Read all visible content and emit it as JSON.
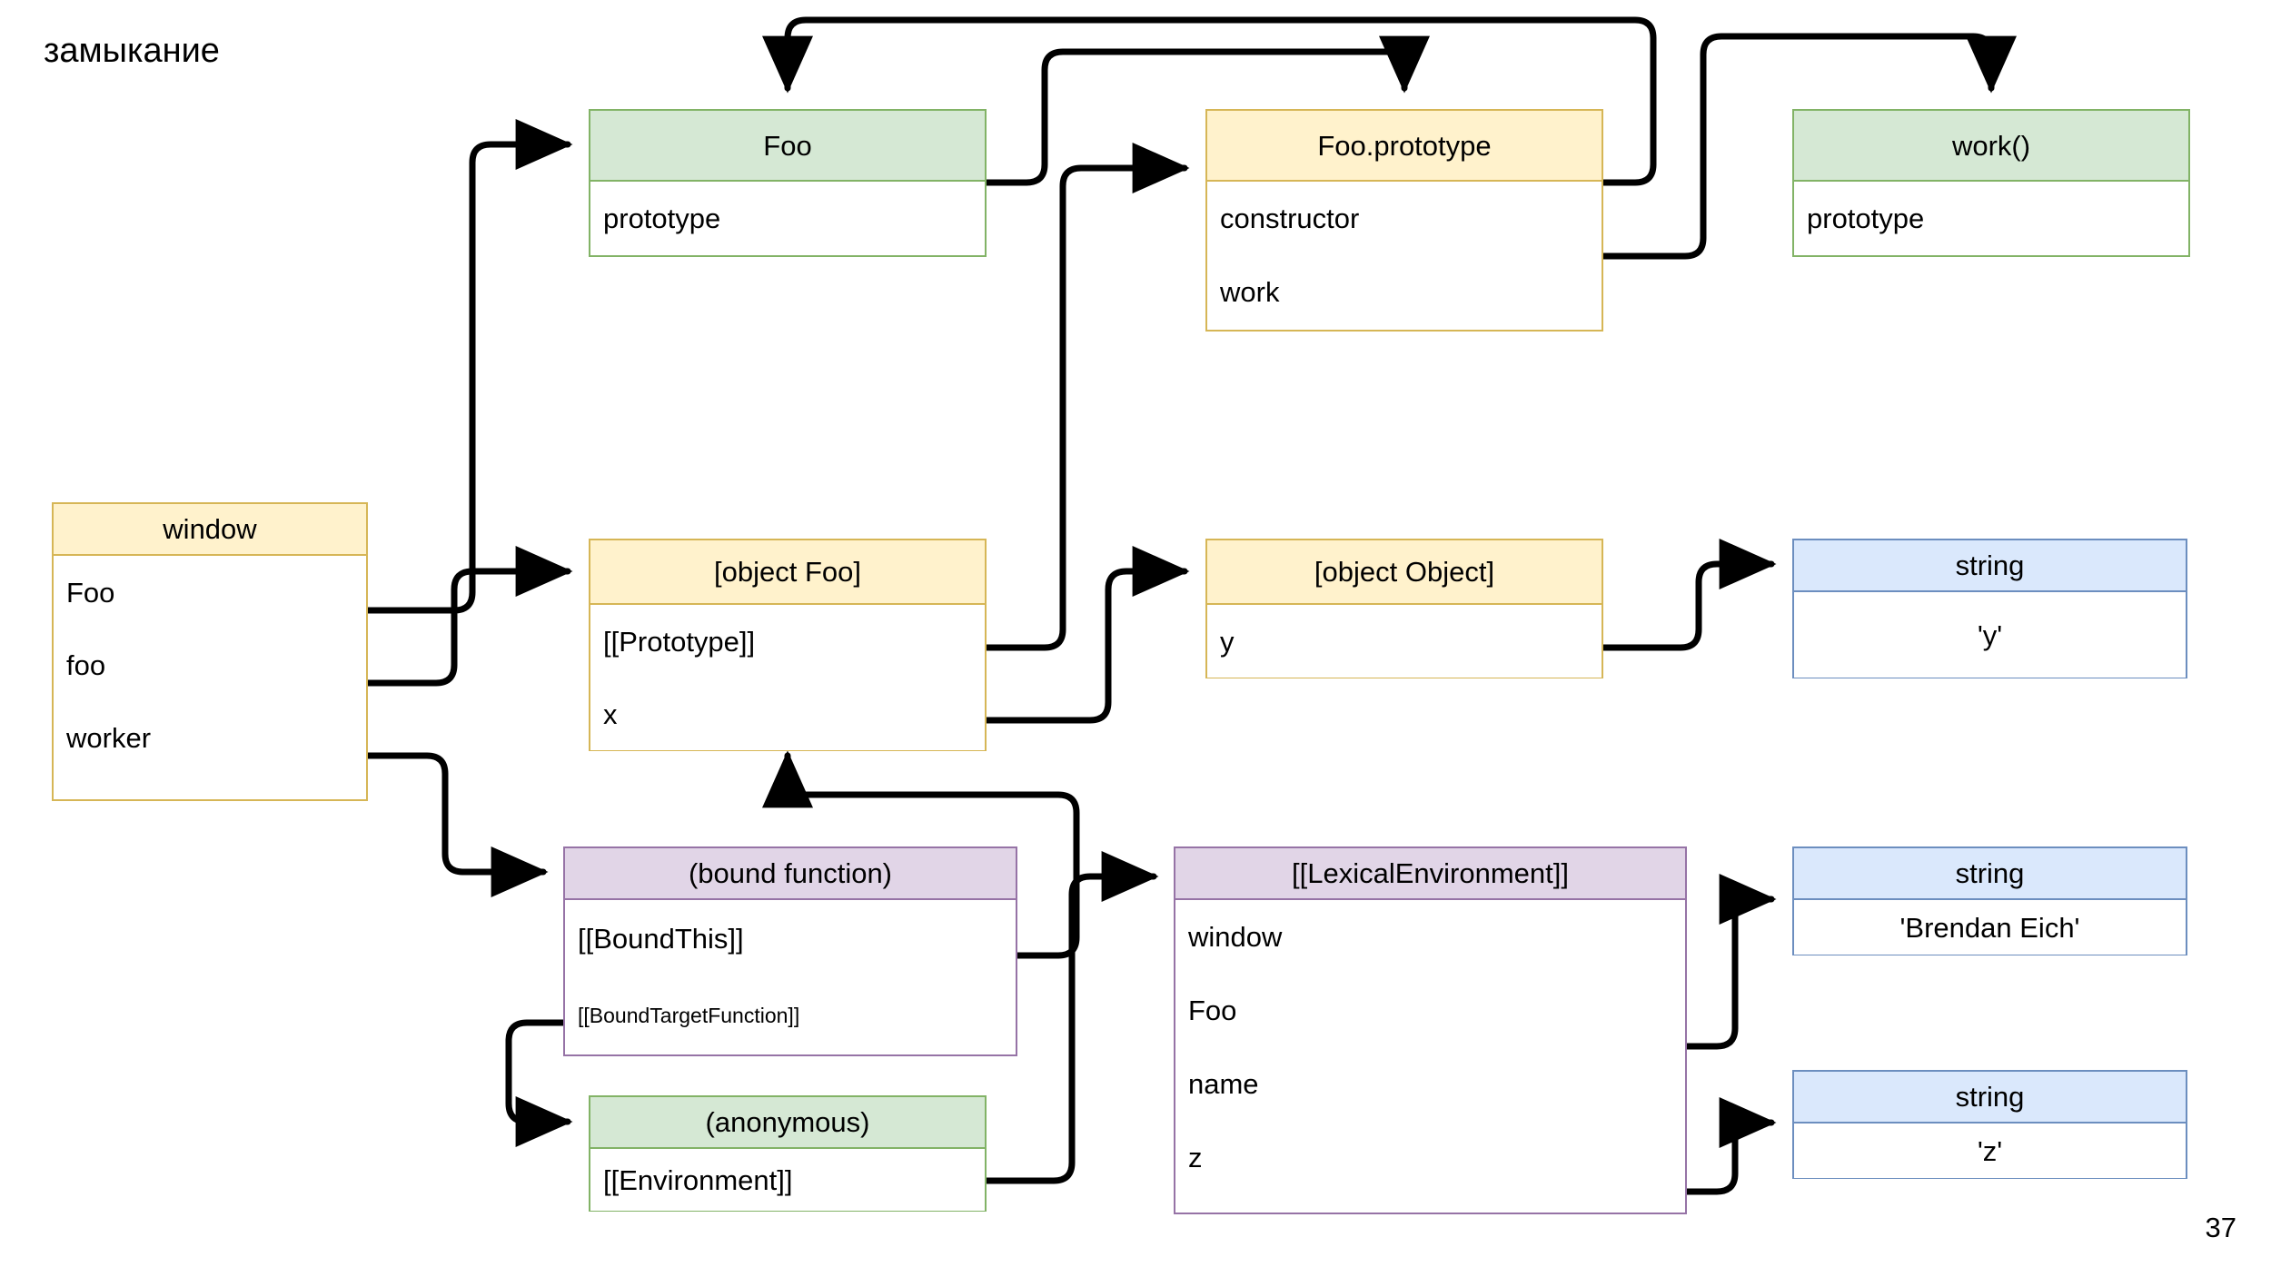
{
  "slide": {
    "title": "замыкание",
    "page_number": "37"
  },
  "colors": {
    "green_fill": "#d5e8d4",
    "green_stroke": "#82b366",
    "yellow_fill": "#fff2cc",
    "yellow_stroke": "#d6b656",
    "blue_fill": "#dae8fc",
    "blue_stroke": "#6c8ebf",
    "purple_fill": "#e1d5e7",
    "purple_stroke": "#9673a6",
    "edge_stroke": "#000000",
    "page_background": "#ffffff"
  },
  "nodes": {
    "foo": {
      "title": "Foo",
      "rows": [
        "prototype"
      ]
    },
    "foo_proto": {
      "title": "Foo.prototype",
      "rows": [
        "constructor",
        "work"
      ]
    },
    "work": {
      "title": "work()",
      "rows": [
        "prototype"
      ]
    },
    "window": {
      "title": "window",
      "rows": [
        "Foo",
        "foo",
        "worker"
      ]
    },
    "object_foo": {
      "title": "[object Foo]",
      "rows": [
        "[[Prototype]]",
        "x"
      ]
    },
    "object_obj": {
      "title": "[object Object]",
      "rows": [
        "y"
      ]
    },
    "string_y": {
      "title": "string",
      "rows": [
        "'y'"
      ]
    },
    "bound_fn": {
      "title": "(bound function)",
      "rows": [
        "[[BoundThis]]",
        "[[BoundTargetFunction]]"
      ]
    },
    "lex_env": {
      "title": "[[LexicalEnvironment]]",
      "rows": [
        "window",
        "Foo",
        "name",
        "z"
      ]
    },
    "string_be": {
      "title": "string",
      "rows": [
        "'Brendan Eich'"
      ]
    },
    "anonymous": {
      "title": "(anonymous)",
      "rows": [
        "[[Environment]]"
      ]
    },
    "string_z": {
      "title": "string",
      "rows": [
        "'z'"
      ]
    }
  },
  "edges": [
    {
      "from": "window.Foo",
      "to": "foo.header"
    },
    {
      "from": "window.foo",
      "to": "object_foo.header"
    },
    {
      "from": "window.worker",
      "to": "bound_fn.header"
    },
    {
      "from": "foo.prototype",
      "to": "foo_proto.header"
    },
    {
      "from": "foo_proto.constructor",
      "to": "foo.header"
    },
    {
      "from": "foo_proto.work",
      "to": "work.header"
    },
    {
      "from": "object_foo.[[Prototype]]",
      "to": "foo_proto.header"
    },
    {
      "from": "object_foo.x",
      "to": "object_obj.header"
    },
    {
      "from": "object_obj.y",
      "to": "string_y.header"
    },
    {
      "from": "bound_fn.[[BoundThis]]",
      "to": "object_foo.bottom"
    },
    {
      "from": "bound_fn.[[BoundTargetFunction]]",
      "to": "anonymous.header"
    },
    {
      "from": "anonymous.[[Environment]]",
      "to": "lex_env.header"
    },
    {
      "from": "lex_env.name",
      "to": "string_be.header"
    },
    {
      "from": "lex_env.z",
      "to": "string_z.header"
    }
  ]
}
